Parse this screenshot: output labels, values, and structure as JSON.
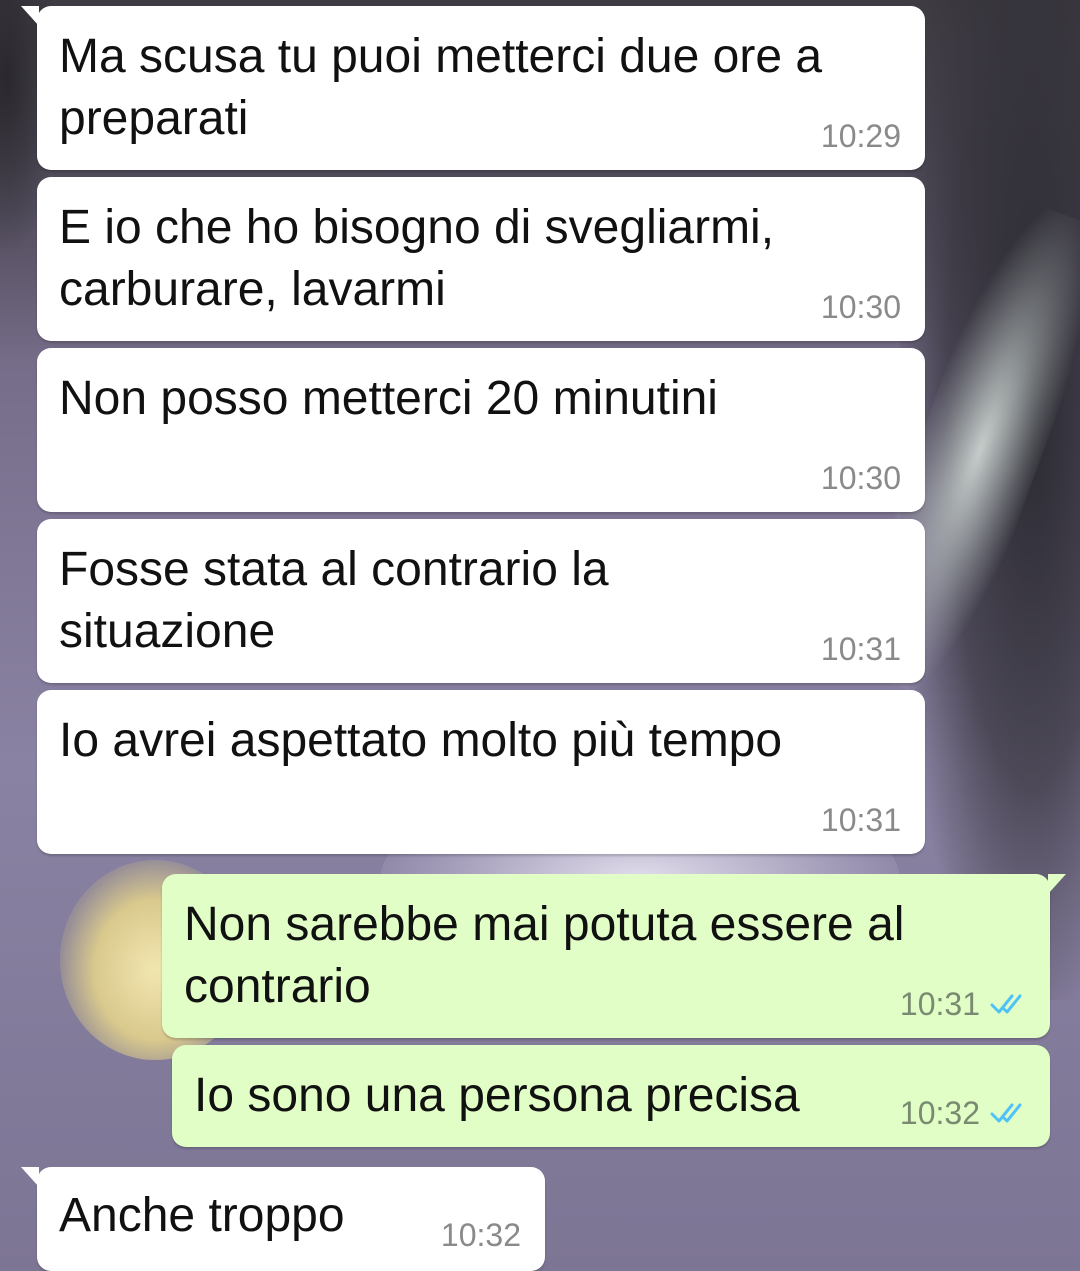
{
  "messages": [
    {
      "direction": "incoming",
      "text": "Ma scusa tu puoi metterci due ore a\npreparati",
      "time": "10:29"
    },
    {
      "direction": "incoming",
      "text": "E io che ho bisogno di svegliarmi,\ncarburare, lavarmi",
      "time": "10:30"
    },
    {
      "direction": "incoming",
      "text": "Non posso metterci 20 minutini",
      "time": "10:30"
    },
    {
      "direction": "incoming",
      "text": "Fosse stata al contrario la\nsituazione",
      "time": "10:31"
    },
    {
      "direction": "incoming",
      "text": "Io avrei aspettato molto più tempo",
      "time": "10:31"
    },
    {
      "direction": "outgoing",
      "text": "Non sarebbe mai potuta essere al\ncontrario",
      "time": "10:31",
      "status_icon": "double-check-read-icon"
    },
    {
      "direction": "outgoing",
      "text": "Io sono una persona precisa",
      "time": "10:32",
      "status_icon": "double-check-read-icon"
    },
    {
      "direction": "incoming",
      "text": "Anche troppo",
      "time": "10:32"
    }
  ],
  "colors": {
    "incoming_bubble": "#ffffff",
    "outgoing_bubble": "#e1fec6",
    "read_ticks": "#4fc3f7",
    "text": "#111111",
    "timestamp": "#8a8a8a"
  }
}
